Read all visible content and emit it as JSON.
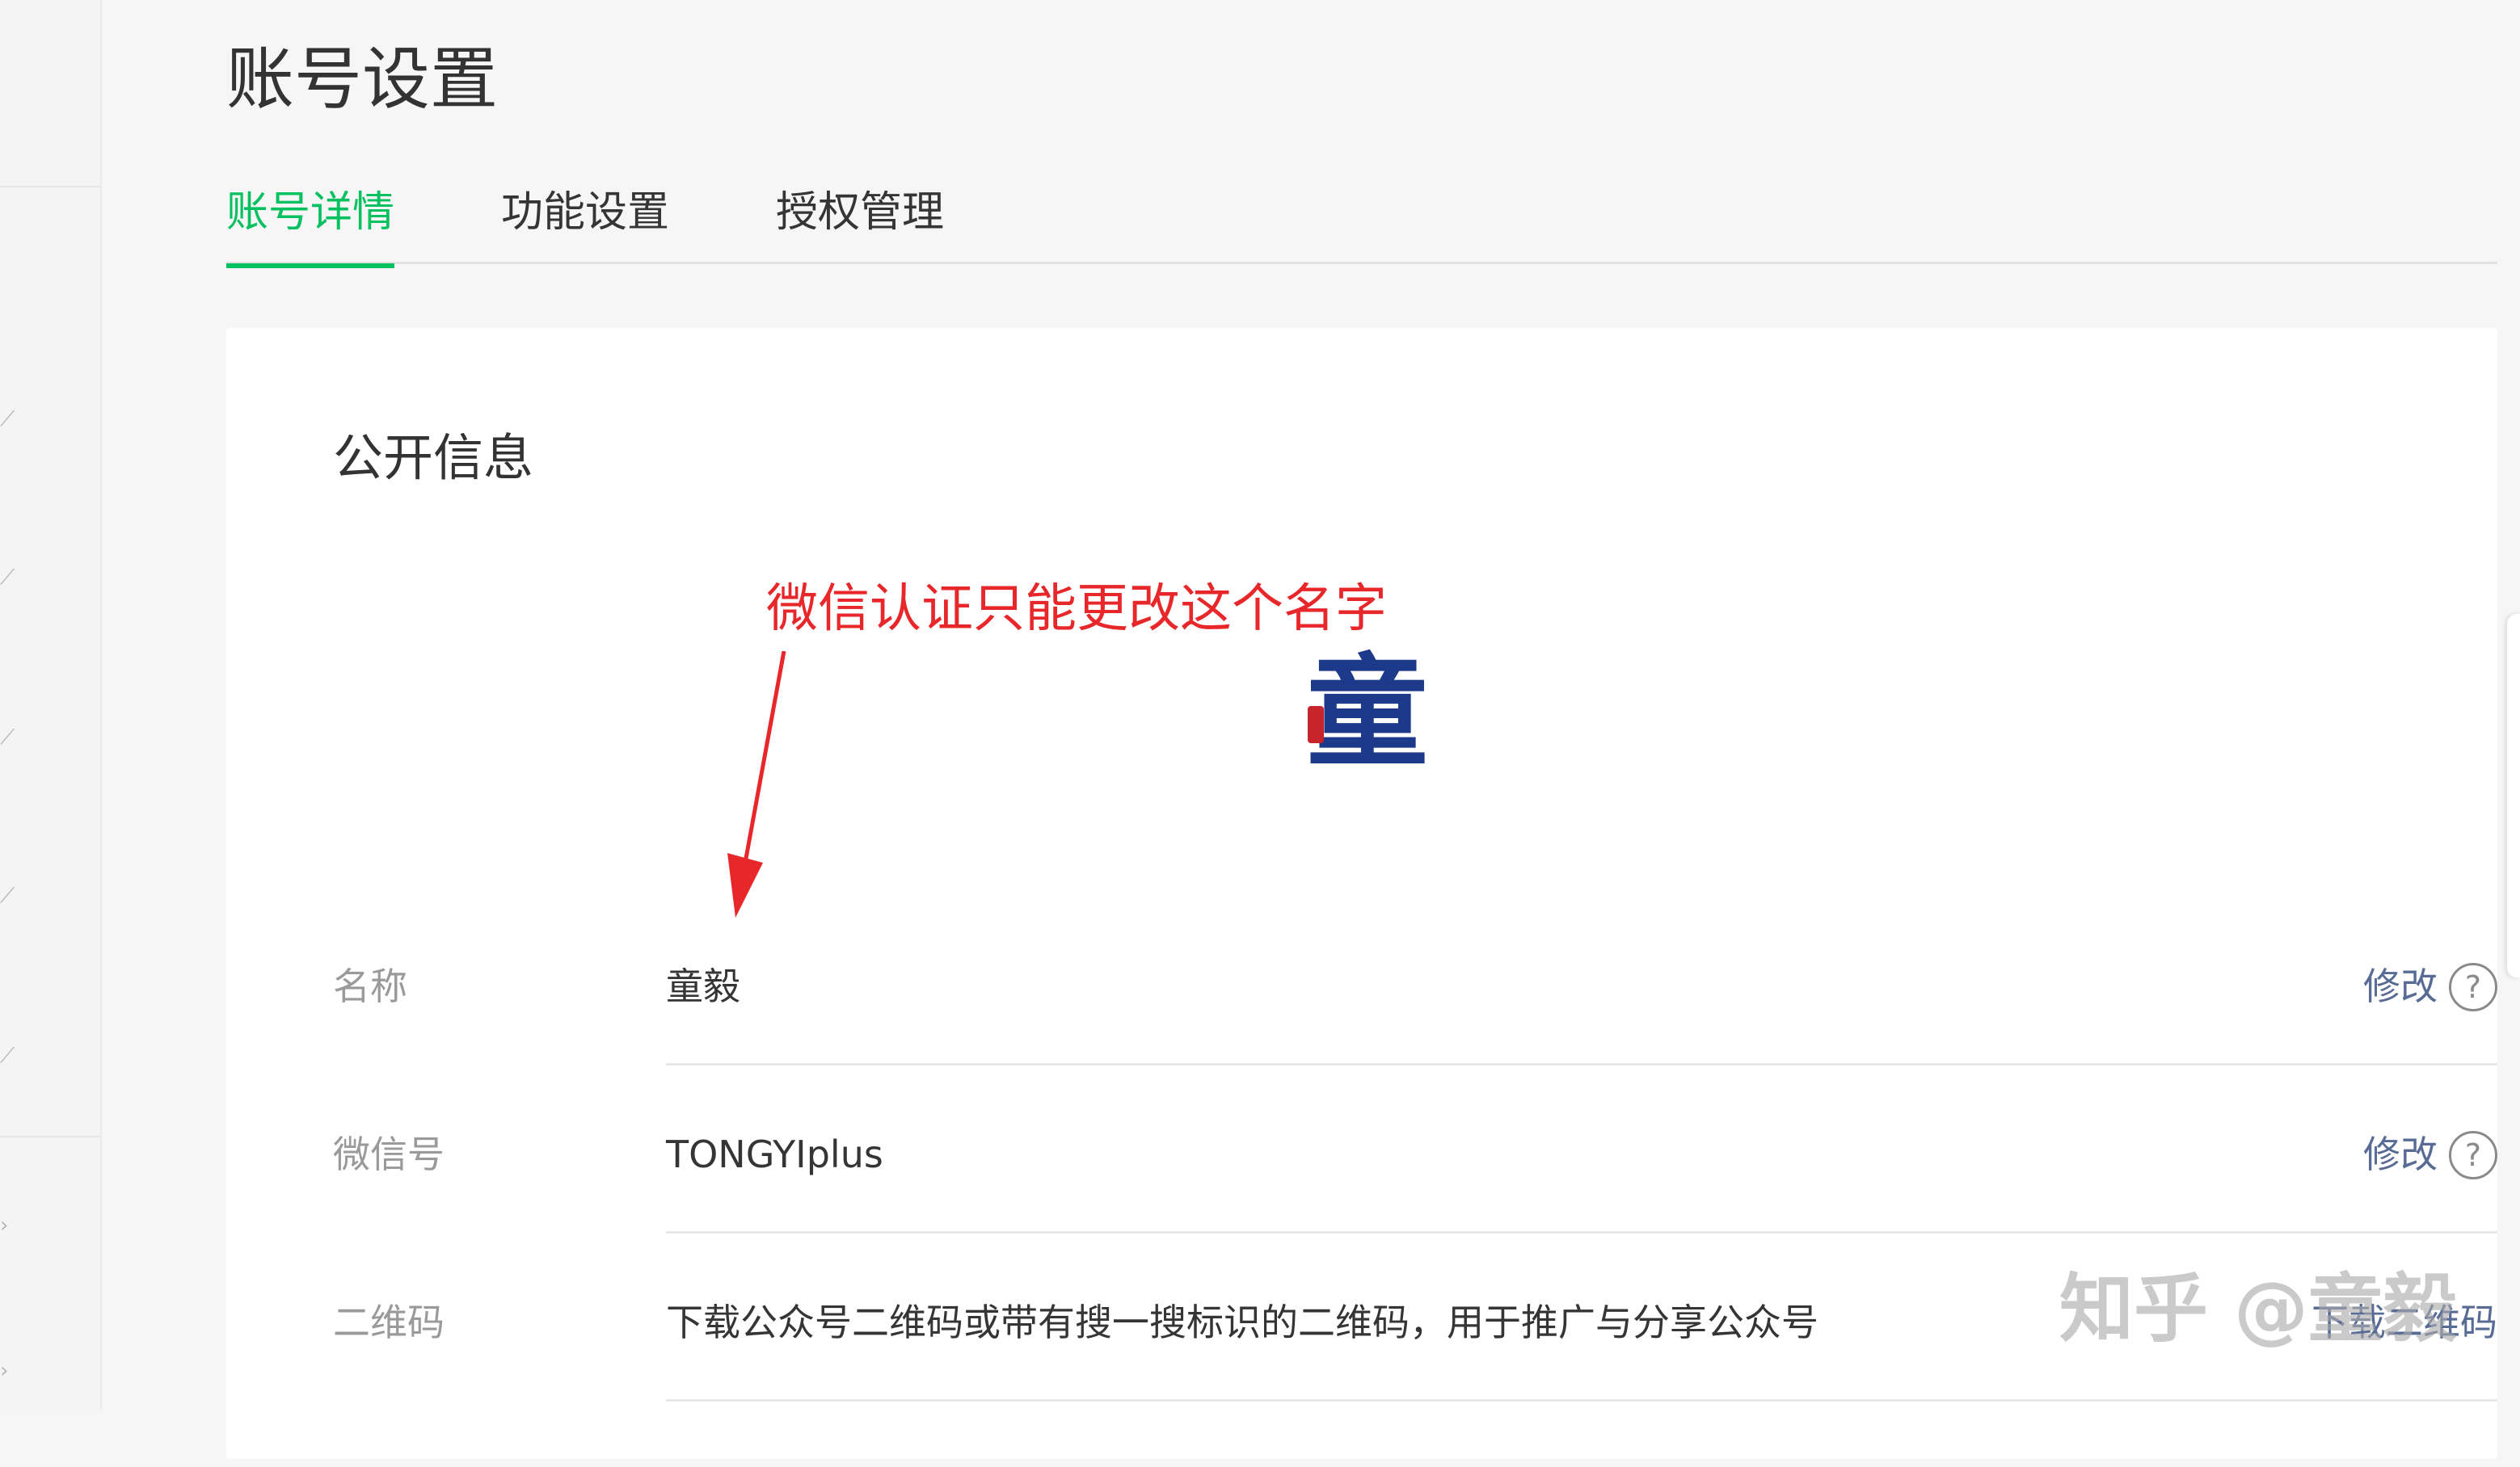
{
  "page": {
    "title": "账号设置"
  },
  "tabs": [
    {
      "label": "账号详情",
      "active": true
    },
    {
      "label": "功能设置",
      "active": false
    },
    {
      "label": "授权管理",
      "active": false
    }
  ],
  "card": {
    "section_title": "公开信息",
    "annotation": "微信认证只能更改这个名字",
    "avatar_glyph": "童",
    "rows": [
      {
        "label": "名称",
        "value": "童毅",
        "action": "修改",
        "help": "?"
      },
      {
        "label": "微信号",
        "value": "TONGYIplus",
        "action": "修改",
        "help": "?"
      },
      {
        "label": "二维码",
        "value": "下载公众号二维码或带有搜一搜标识的二维码，用于推广与分享公众号",
        "action": "下载二维码"
      }
    ]
  },
  "watermark": "知乎 @童毅",
  "colors": {
    "accent": "#07c160",
    "link": "#576b95",
    "annotation": "#e8272b",
    "background": "#f6f6f6"
  }
}
